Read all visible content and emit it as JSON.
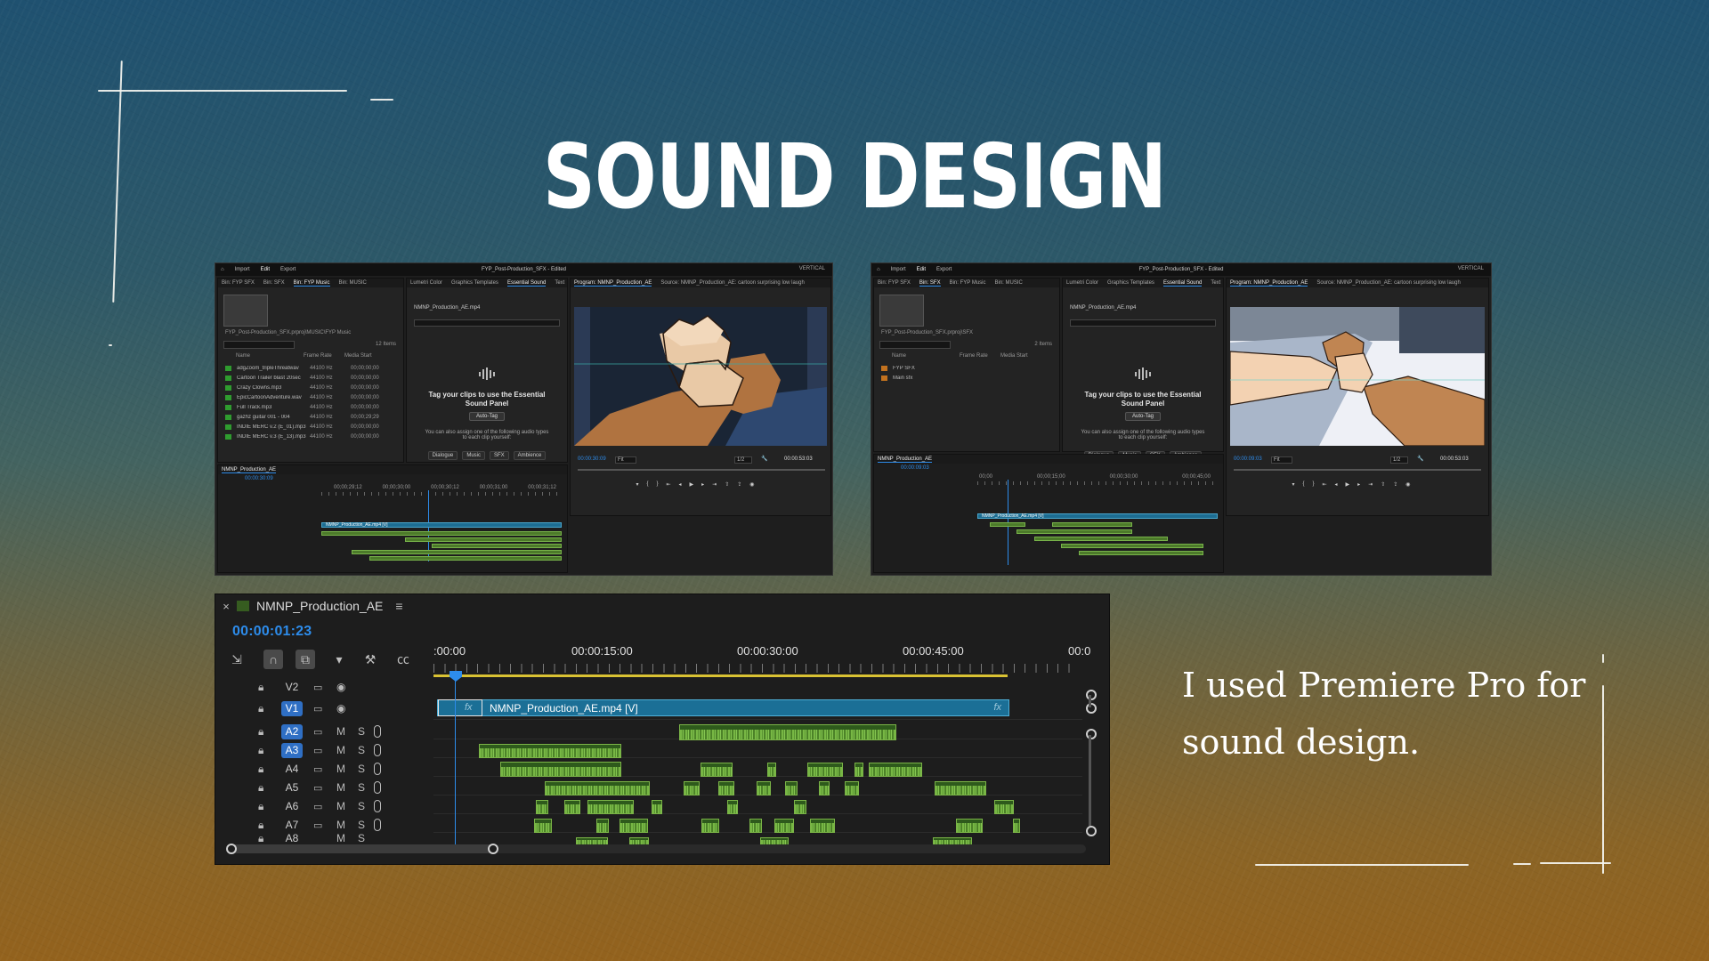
{
  "slide": {
    "title": "SOUND DESIGN",
    "caption": "I used Premiere Pro for sound design."
  },
  "shot_left": {
    "nav": [
      "Import",
      "Edit",
      "Export"
    ],
    "project_title": "FYP_Post-Production_SFX - Edited",
    "workspace": "VERTICAL",
    "bin_tabs": [
      "Bin: FYP SFX",
      "Bin: SFX",
      "Bin: FYP Music",
      "Bin: MUSIC"
    ],
    "panel_tabs": [
      "Lumetri Color",
      "Graphics Templates",
      "Essential Sound",
      "Text"
    ],
    "program_tab": "Program: NMNP_Production_AE",
    "source_tab": "Source: NMNP_Production_AE: cartoon surprising low laugh",
    "bin_path": "FYP_Post-Production_SFX.prproj\\MUSIC\\FYP Music",
    "items_count": "12 Items",
    "columns": [
      "Name",
      "Frame Rate",
      "Media Start"
    ],
    "files": [
      {
        "name": "adgZoom_tripleThreatwav",
        "rate": "44100 Hz",
        "dur": "00;00;00;00"
      },
      {
        "name": "Cartoon Trailer blast 20sec",
        "rate": "44100 Hz",
        "dur": "00;00;00;00"
      },
      {
        "name": "Crazy Clowns.mp3",
        "rate": "44100 Hz",
        "dur": "00;00;00;00"
      },
      {
        "name": "EpicCartoonAdventure.wav",
        "rate": "44100 Hz",
        "dur": "00;00;00;00"
      },
      {
        "name": "Full Track.mp3",
        "rate": "44100 Hz",
        "dur": "00;00;00;00"
      },
      {
        "name": "gazhz guitar 001 - 004",
        "rate": "44100 Hz",
        "dur": "00;00;29;29"
      },
      {
        "name": "INDIE MERC v.2 (E_01).mp3",
        "rate": "44100 Hz",
        "dur": "00;00;00;00"
      },
      {
        "name": "INDIE MERC v.3 (E_13).mp3",
        "rate": "44100 Hz",
        "dur": "00;00;00;00"
      }
    ],
    "essential_clip": "NMNP_Production_AE.mp4",
    "essential_msg": "Tag your clips to use the Essential Sound Panel",
    "auto_tag": "Auto-Tag",
    "essential_sub": "You can also assign one of the following audio types to each clip yourself:",
    "tags": [
      "Dialogue",
      "Music",
      "SFX",
      "Ambience"
    ],
    "seq_tab": "NMNP_Production_AE",
    "seq_tc": "00:00:30:09",
    "prog_tc": "00:00:30:09",
    "fit": "Fit",
    "quality": "1/2",
    "prog_dur": "00:00:53:03",
    "vclip_label": "NMNP_Production_AE.mp4 [V]",
    "ruler": [
      "00;00;29;12",
      "00;00;30;00",
      "00;00;30;12",
      "00;00;31;00",
      "00;00;31;12"
    ]
  },
  "shot_right": {
    "nav": [
      "Import",
      "Edit",
      "Export"
    ],
    "project_title": "FYP_Post-Production_SFX - Edited",
    "workspace": "VERTICAL",
    "bin_tabs": [
      "Bin: FYP SFX",
      "Bin: SFX",
      "Bin: FYP Music",
      "Bin: MUSIC"
    ],
    "panel_tabs": [
      "Lumetri Color",
      "Graphics Templates",
      "Essential Sound",
      "Text"
    ],
    "program_tab": "Program: NMNP_Production_AE",
    "source_tab": "Source: NMNP_Production_AE: cartoon surprising low laugh",
    "bin_path": "FYP_Post-Production_SFX.prproj\\SFX",
    "items_count": "2 Items",
    "columns": [
      "Name",
      "Frame Rate",
      "Media Start"
    ],
    "folders": [
      "FYP SFX",
      "Main sfx"
    ],
    "essential_clip": "NMNP_Production_AE.mp4",
    "essential_msg": "Tag your clips to use the Essential Sound Panel",
    "auto_tag": "Auto-Tag",
    "essential_sub": "You can also assign one of the following audio types to each clip yourself:",
    "tags": [
      "Dialogue",
      "Music",
      "SFX",
      "Ambience"
    ],
    "seq_tab": "NMNP_Production_AE",
    "seq_tc": "00:00:09:03",
    "prog_tc": "00:00:09:03",
    "fit": "Fit",
    "quality": "1/2",
    "prog_dur": "00:00:53:03",
    "vclip_label": "NMNP_Production_AE.mp4 [V]",
    "ruler": [
      "00;00",
      "00;00;15;00",
      "00;00;30;00",
      "00;00;45;00"
    ]
  },
  "timeline": {
    "close": "×",
    "sequence_name": "NMNP_Production_AE",
    "menu": "≡",
    "timecode": "00:00:01:23",
    "ruler_labels": [
      ":00:00",
      "00:00:15:00",
      "00:00:30:00",
      "00:00:45:00",
      "00:0"
    ],
    "video_clip_label": "NMNP_Production_AE.mp4 [V]",
    "fx": "fx",
    "tracks": [
      {
        "name": "V2",
        "type": "video",
        "selected": false
      },
      {
        "name": "V1",
        "type": "video",
        "selected": true
      },
      {
        "name": "A2",
        "type": "audio",
        "selected": true
      },
      {
        "name": "A3",
        "type": "audio",
        "selected": true
      },
      {
        "name": "A4",
        "type": "audio",
        "selected": false
      },
      {
        "name": "A5",
        "type": "audio",
        "selected": false
      },
      {
        "name": "A6",
        "type": "audio",
        "selected": false
      },
      {
        "name": "A7",
        "type": "audio",
        "selected": false
      },
      {
        "name": "A8",
        "type": "audio",
        "selected": false
      }
    ],
    "mute": "M",
    "solo": "S",
    "icons": {
      "lock": "lock-icon",
      "eye": "eye-icon",
      "sync": "sync-lock-icon",
      "mic": "mic-icon"
    }
  }
}
